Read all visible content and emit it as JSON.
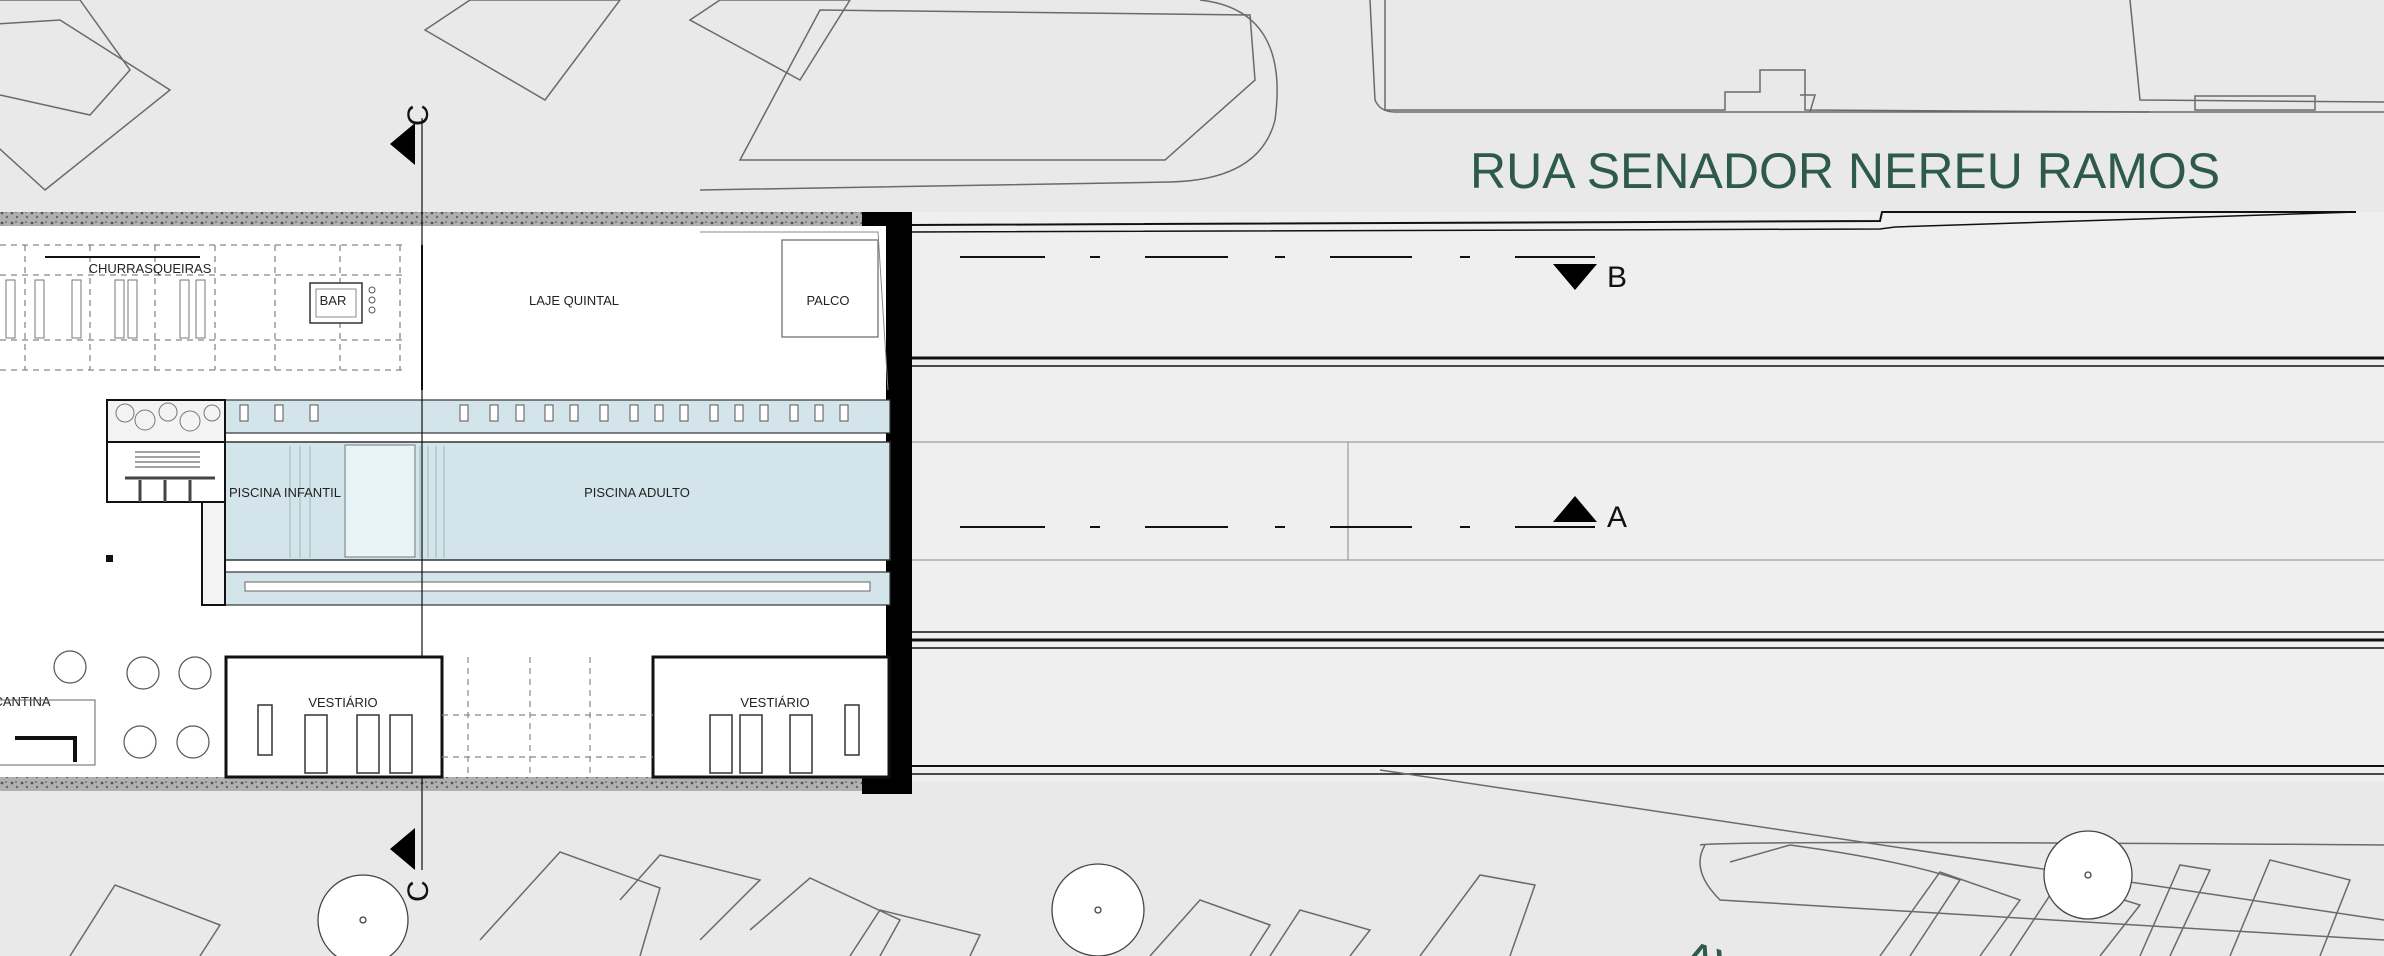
{
  "street_labels": {
    "main": "RUA SENADOR NEREU RAMOS",
    "bottom_partial": "AV"
  },
  "rooms": {
    "churrasqueiras": "CHURRASQUEIRAS",
    "bar": "BAR",
    "laje_quintal": "LAJE QUINTAL",
    "palco": "PALCO",
    "piscina_infantil": "PISCINA INFANTIL",
    "piscina_adulto": "PISCINA ADULTO",
    "cantina": "CANTINA",
    "vestiario_left": "VESTIÁRIO",
    "vestiario_right": "VESTIÁRIO"
  },
  "section_markers": {
    "a": "A",
    "b": "B",
    "c_top": "C",
    "c_bottom": "C"
  },
  "colors": {
    "background": "#e9e9e9",
    "lot": "#ffffff",
    "pool": "#d3e4ea",
    "pool_shallow": "#e8f5f8",
    "street_text": "#2e5a4a",
    "wall": "#000000"
  }
}
